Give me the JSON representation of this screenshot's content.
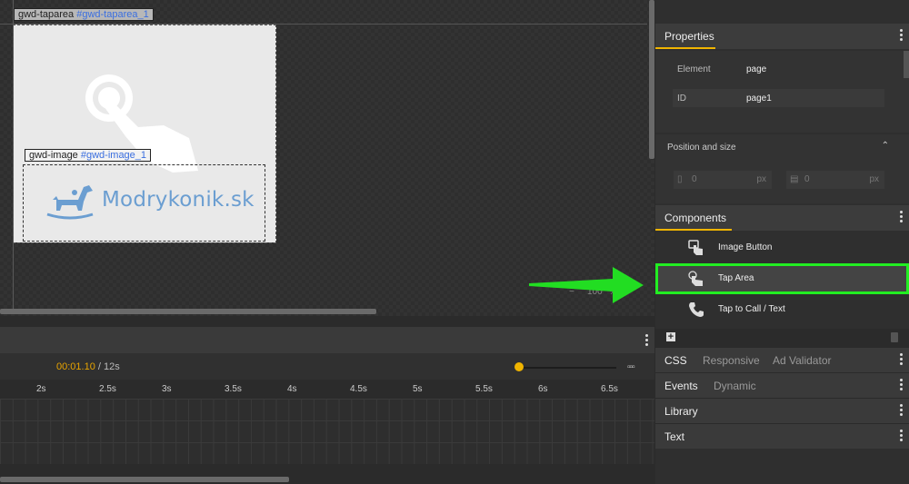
{
  "stage": {
    "taparea_tag": {
      "name": "gwd-taparea",
      "id": "#gwd-taparea_1"
    },
    "image_tag": {
      "name": "gwd-image",
      "id": "#gwd-image_1"
    },
    "logo_text": "Modrykonik.sk",
    "zoom": {
      "minus": "−",
      "value": "100",
      "unit": "%"
    }
  },
  "timeline": {
    "current_time": "00:01.10",
    "total_time": "/ 12s",
    "ticks": [
      "2s",
      "2.5s",
      "3s",
      "3.5s",
      "4s",
      "4.5s",
      "5s",
      "5.5s",
      "6s",
      "6.5s"
    ]
  },
  "panel": {
    "properties": {
      "title": "Properties",
      "element_label": "Element",
      "element_value": "page",
      "id_label": "ID",
      "id_value": "page1"
    },
    "position_size": {
      "title": "Position and size",
      "left_value": "0",
      "top_value": "0",
      "unit": "px"
    },
    "components": {
      "title": "Components",
      "items": [
        {
          "label": "Image Button",
          "icon": "hand-touch-icon"
        },
        {
          "label": "Tap Area",
          "icon": "hand-tap-icon"
        },
        {
          "label": "Tap to Call / Text",
          "icon": "phone-icon"
        }
      ]
    },
    "tabs": {
      "css": "CSS",
      "responsive": "Responsive",
      "ad_validator": "Ad Validator",
      "events": "Events",
      "dynamic": "Dynamic",
      "library": "Library",
      "text": "Text"
    }
  },
  "colors": {
    "accent": "#f0b400",
    "highlight": "#22ee22",
    "id_link": "#3b6fe0",
    "logo": "#6b9ed1"
  }
}
